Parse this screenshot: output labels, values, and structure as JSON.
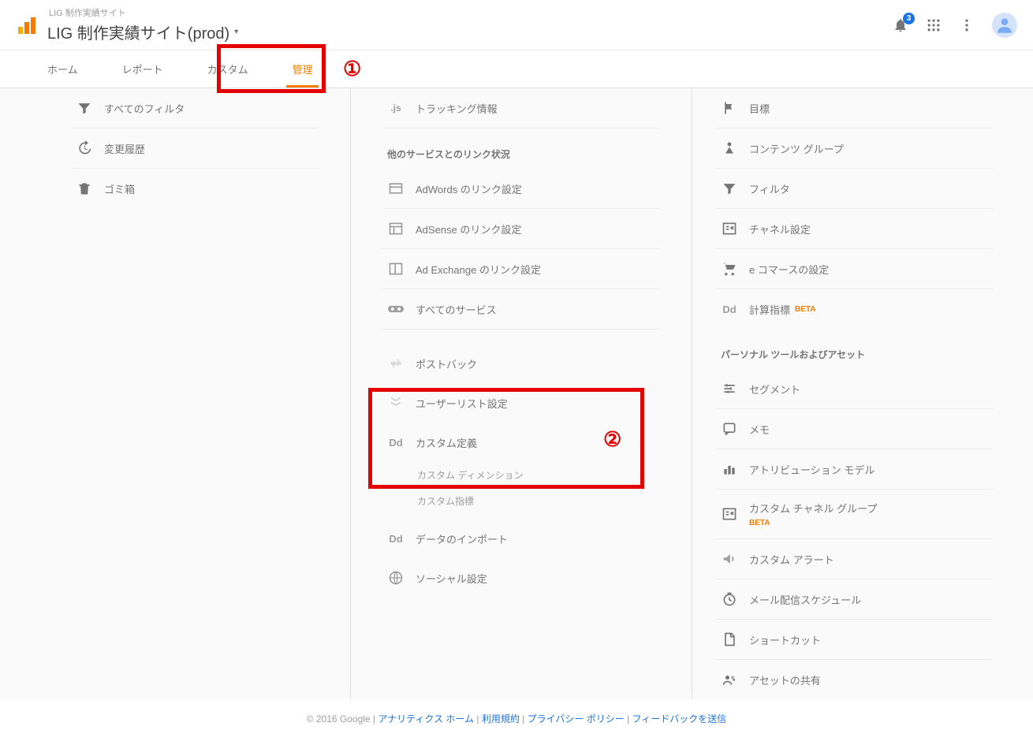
{
  "header": {
    "subtitle": "LIG 制作実績サイト",
    "title": "LIG 制作実績サイト(prod)",
    "notif_count": "3"
  },
  "nav": {
    "home": "ホーム",
    "report": "レポート",
    "custom": "カスタム",
    "admin": "管理"
  },
  "annotations": {
    "n1": "①",
    "n2": "②"
  },
  "col1": {
    "filters": "すべてのフィルタ",
    "history": "変更履歴",
    "trash": "ゴミ箱"
  },
  "col2": {
    "tracking": "トラッキング情報",
    "section_links": "他のサービスとのリンク状況",
    "adwords": "AdWords のリンク設定",
    "adsense": "AdSense のリンク設定",
    "adexchange": "Ad Exchange のリンク設定",
    "all_services": "すべてのサービス",
    "postback": "ポストバック",
    "userlist": "ユーザーリスト設定",
    "custom_def": "カスタム定義",
    "custom_dim": "カスタム ディメンション",
    "custom_metric": "カスタム指標",
    "data_import": "データのインポート",
    "social": "ソーシャル設定"
  },
  "col3": {
    "goals": "目標",
    "content_group": "コンテンツ グループ",
    "filter": "フィルタ",
    "channel": "チャネル設定",
    "ecommerce": "e コマースの設定",
    "calc_metric": "計算指標",
    "beta": "BETA",
    "section_personal": "パーソナル ツールおよびアセット",
    "segment": "セグメント",
    "memo": "メモ",
    "attribution": "アトリビューション モデル",
    "custom_channel": "カスタム チャネル グループ",
    "custom_alert": "カスタム アラート",
    "mail_schedule": "メール配信スケジュール",
    "shortcut": "ショートカット",
    "asset_share": "アセットの共有"
  },
  "footer": {
    "copyright": "© 2016 Google",
    "sep": " | ",
    "link1": "アナリティクス ホーム",
    "link2": "利用規約",
    "link3": "プライバシー ポリシー",
    "link4": "フィードバックを送信"
  }
}
